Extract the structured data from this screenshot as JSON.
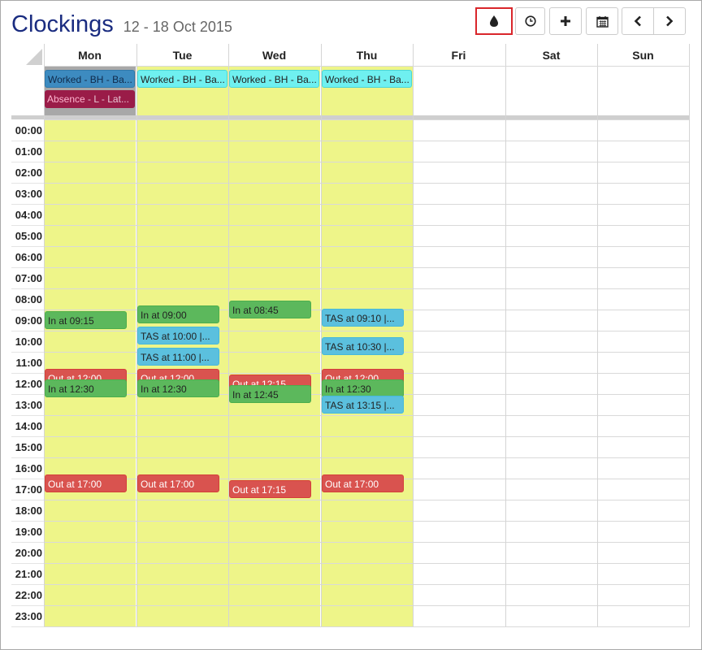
{
  "header": {
    "title": "Clockings",
    "date_range": "12 - 18 Oct 2015"
  },
  "toolbar": {
    "buttons": [
      {
        "name": "color-button",
        "icon": "drop-icon",
        "active": true
      },
      {
        "name": "clock-button",
        "icon": "clock-icon",
        "active": false
      },
      {
        "name": "add-button",
        "icon": "plus-icon",
        "active": false
      },
      {
        "name": "calendar-button",
        "icon": "calendar-icon",
        "active": false
      },
      {
        "name": "previous-button",
        "icon": "chevron-left-icon",
        "active": false
      },
      {
        "name": "next-button",
        "icon": "chevron-right-icon",
        "active": false
      }
    ]
  },
  "calendar": {
    "days": [
      "Mon",
      "Tue",
      "Wed",
      "Thu",
      "Fri",
      "Sat",
      "Sun"
    ],
    "hours": [
      "00:00",
      "01:00",
      "02:00",
      "03:00",
      "04:00",
      "05:00",
      "06:00",
      "07:00",
      "08:00",
      "09:00",
      "10:00",
      "11:00",
      "12:00",
      "13:00",
      "14:00",
      "15:00",
      "16:00",
      "17:00",
      "18:00",
      "19:00",
      "20:00",
      "21:00",
      "22:00",
      "23:00"
    ],
    "colors": {
      "working_day": "#eef589",
      "in": "#5cb85c",
      "out": "#d9534f",
      "tas": "#5bc0de",
      "worked": "#6ff0f0",
      "worked_selected": "#3d8bc0",
      "absence": "#9a1c48",
      "title": "#1a2c80"
    },
    "allday_events": [
      {
        "day": 0,
        "text": "Worked - BH - Ba...",
        "style": "steel"
      },
      {
        "day": 0,
        "text": "Absence",
        "tail": " - L - Lat...",
        "style": "absence"
      },
      {
        "day": 1,
        "text": "Worked - BH - Ba...",
        "style": "cyan"
      },
      {
        "day": 2,
        "text": "Worked - BH - Ba...",
        "style": "cyan"
      },
      {
        "day": 3,
        "text": "Worked - BH - Ba...",
        "style": "cyan"
      }
    ],
    "events": [
      {
        "day": 0,
        "text": "In at 09:15",
        "type": "green",
        "start": 9.25
      },
      {
        "day": 0,
        "text": "Out at 12:00",
        "type": "red",
        "start": 12.0
      },
      {
        "day": 0,
        "text": "In at 12:30",
        "type": "green",
        "start": 12.5
      },
      {
        "day": 0,
        "text": "Out at 17:00",
        "type": "red",
        "start": 17.0
      },
      {
        "day": 1,
        "text": "In at 09:00",
        "type": "green",
        "start": 9.0
      },
      {
        "day": 1,
        "text": "TAS at 10:00 |...",
        "type": "blue",
        "start": 10.0
      },
      {
        "day": 1,
        "text": "TAS at 11:00 |...",
        "type": "blue",
        "start": 11.0
      },
      {
        "day": 1,
        "text": "Out at 12:00",
        "type": "red",
        "start": 12.0
      },
      {
        "day": 1,
        "text": "In at 12:30",
        "type": "green",
        "start": 12.5
      },
      {
        "day": 1,
        "text": "Out at 17:00",
        "type": "red",
        "start": 17.0
      },
      {
        "day": 2,
        "text": "In at 08:45",
        "type": "green",
        "start": 8.75
      },
      {
        "day": 2,
        "text": "Out at 12:15",
        "type": "red",
        "start": 12.25
      },
      {
        "day": 2,
        "text": "In at 12:45",
        "type": "green",
        "start": 12.75
      },
      {
        "day": 2,
        "text": "Out at 17:15",
        "type": "red",
        "start": 17.25
      },
      {
        "day": 3,
        "text": "TAS at 09:10 |...",
        "type": "blue",
        "start": 9.17
      },
      {
        "day": 3,
        "text": "TAS at 10:30 |...",
        "type": "blue",
        "start": 10.5
      },
      {
        "day": 3,
        "text": "Out at 12:00",
        "type": "red",
        "start": 12.0
      },
      {
        "day": 3,
        "text": "In at 12:30",
        "type": "green",
        "start": 12.5
      },
      {
        "day": 3,
        "text": "TAS at 13:15 |...",
        "type": "blue",
        "start": 13.25
      },
      {
        "day": 3,
        "text": "Out at 17:00",
        "type": "red",
        "start": 17.0
      }
    ]
  }
}
